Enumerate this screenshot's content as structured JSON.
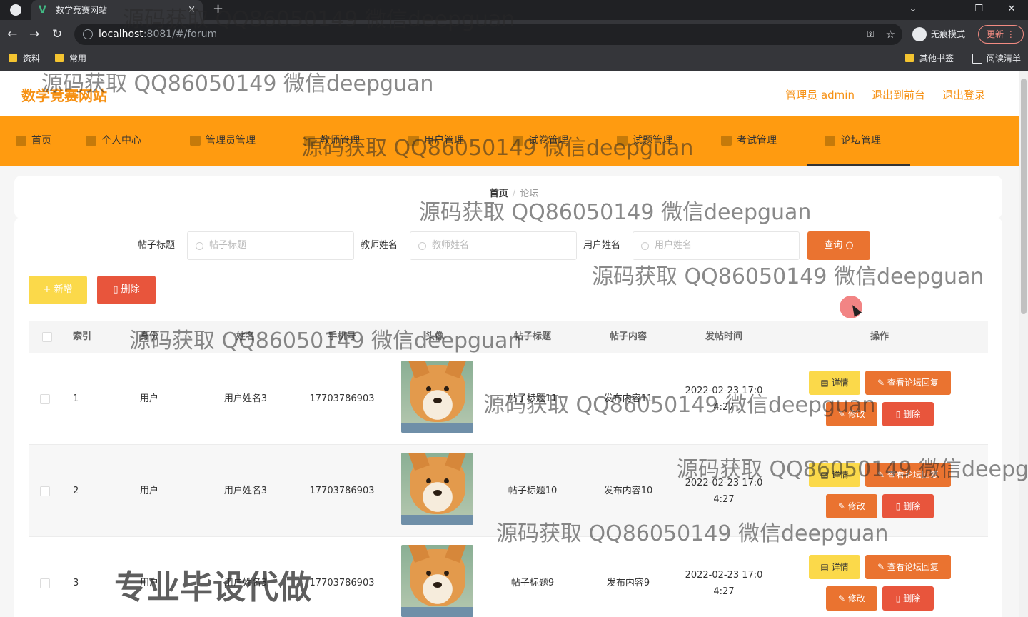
{
  "browser": {
    "tab_title": "数学竞赛网站",
    "tab_close": "×",
    "new_tab": "+",
    "url_host": "localhost",
    "url_rest": ":8081/#/forum",
    "incognito_label": "无痕模式",
    "update_label": "更新",
    "bookmarks": [
      "资料",
      "常用"
    ],
    "bookmarks_right": [
      "其他书签",
      "阅读清单"
    ]
  },
  "site": {
    "logo": "数学竞赛网站",
    "header_links": [
      "管理员 admin",
      "退出到前台",
      "退出登录"
    ]
  },
  "menu": [
    {
      "label": "首页",
      "icon": "home-icon"
    },
    {
      "label": "个人中心",
      "icon": "user-icon"
    },
    {
      "label": "管理员管理",
      "icon": "admin-icon"
    },
    {
      "label": "教师管理",
      "icon": "teacher-icon"
    },
    {
      "label": "用户管理",
      "icon": "users-icon"
    },
    {
      "label": "试卷管理",
      "icon": "paper-icon"
    },
    {
      "label": "试题管理",
      "icon": "question-icon"
    },
    {
      "label": "考试管理",
      "icon": "exam-icon"
    },
    {
      "label": "论坛管理",
      "icon": "forum-icon",
      "active": true
    }
  ],
  "breadcrumb": {
    "home": "首页",
    "sep": "/",
    "current": "论坛"
  },
  "search": {
    "fields": [
      {
        "label": "帖子标题",
        "placeholder": "帖子标题"
      },
      {
        "label": "教师姓名",
        "placeholder": "教师姓名"
      },
      {
        "label": "用户姓名",
        "placeholder": "用户姓名"
      }
    ],
    "query_button": "查询"
  },
  "actions": {
    "add": "+ 新增",
    "delete": "删除"
  },
  "table": {
    "headers": [
      "索引",
      "身份",
      "姓名",
      "手机号",
      "头像",
      "帖子标题",
      "帖子内容",
      "发帖时间",
      "操作"
    ],
    "rows": [
      {
        "index": "1",
        "role": "用户",
        "name": "用户姓名3",
        "phone": "17703786903",
        "title": "帖子标题11",
        "content": "发布内容11",
        "time_line1": "2022-02-23 17:0",
        "time_line2": "4:27"
      },
      {
        "index": "2",
        "role": "用户",
        "name": "用户姓名3",
        "phone": "17703786903",
        "title": "帖子标题10",
        "content": "发布内容10",
        "time_line1": "2022-02-23 17:0",
        "time_line2": "4:27"
      },
      {
        "index": "3",
        "role": "用户",
        "name": "用户姓名3",
        "phone": "17703786903",
        "title": "帖子标题9",
        "content": "发布内容9",
        "time_line1": "2022-02-23 17:0",
        "time_line2": "4:27"
      }
    ],
    "row_actions": {
      "detail": "详情",
      "view_replies": "查看论坛回复",
      "edit": "修改",
      "delete": "删除"
    }
  },
  "watermarks": {
    "text": "源码获取 QQ86050149 微信deepguan",
    "promo": "专业毕设代做"
  },
  "colors": {
    "accent": "#ff9b10",
    "logo": "#f69114",
    "query": "#ea7330",
    "add": "#fbd94a",
    "delete": "#e8553c"
  }
}
